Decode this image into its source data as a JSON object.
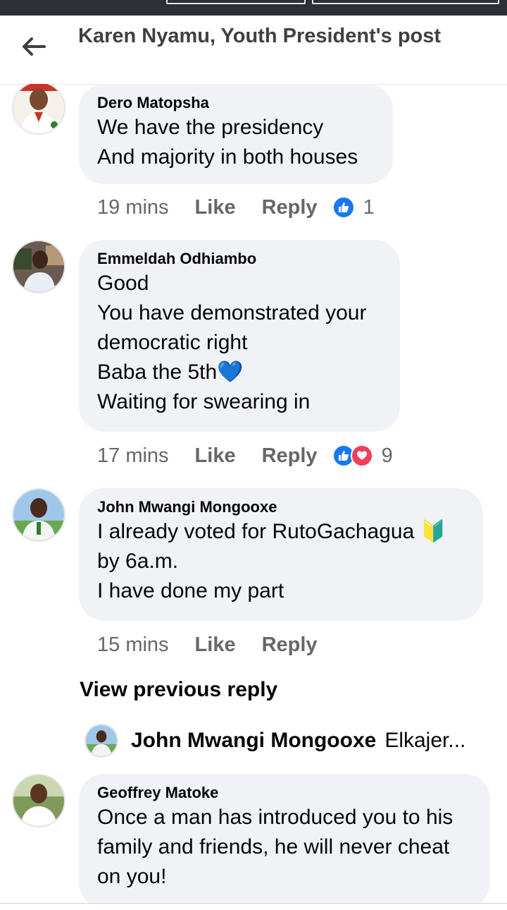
{
  "header": {
    "title": "Karen Nyamu, Youth President's post",
    "back_icon": "arrow-left-icon"
  },
  "comments": [
    {
      "author": "Dero Matopsha",
      "lines": [
        "We have the presidency",
        "And majority in both houses"
      ],
      "time": "19 mins",
      "like_label": "Like",
      "reply_label": "Reply",
      "reactions": [
        "like"
      ],
      "reaction_count": "1"
    },
    {
      "author": "Emmeldah Odhiambo",
      "lines": [
        "Good",
        "You have demonstrated your",
        "democratic right",
        "Baba the 5th💙",
        "Waiting for swearing in"
      ],
      "time": "17 mins",
      "like_label": "Like",
      "reply_label": "Reply",
      "reactions": [
        "like",
        "love"
      ],
      "reaction_count": "9"
    },
    {
      "author": "John Mwangi Mongooxe",
      "lines": [
        "I already voted for RutoGachagua 🔰",
        "by 6a.m.",
        "I have done my part"
      ],
      "time": "15 mins",
      "like_label": "Like",
      "reply_label": "Reply",
      "reactions": [],
      "reaction_count": ""
    },
    {
      "author": "Geoffrey Matoke",
      "lines": [
        "Once a man has introduced you to his",
        "family and friends, he will never cheat",
        "on you!"
      ]
    }
  ],
  "view_previous": "View previous reply",
  "reply_preview": {
    "name": "John Mwangi Mongooxe",
    "text": "Elkajer..."
  },
  "colors": {
    "bubble": "#f0f2f5",
    "meta_text": "#65676b",
    "like_blue": "#1877f2",
    "love_red": "#f33e58"
  }
}
